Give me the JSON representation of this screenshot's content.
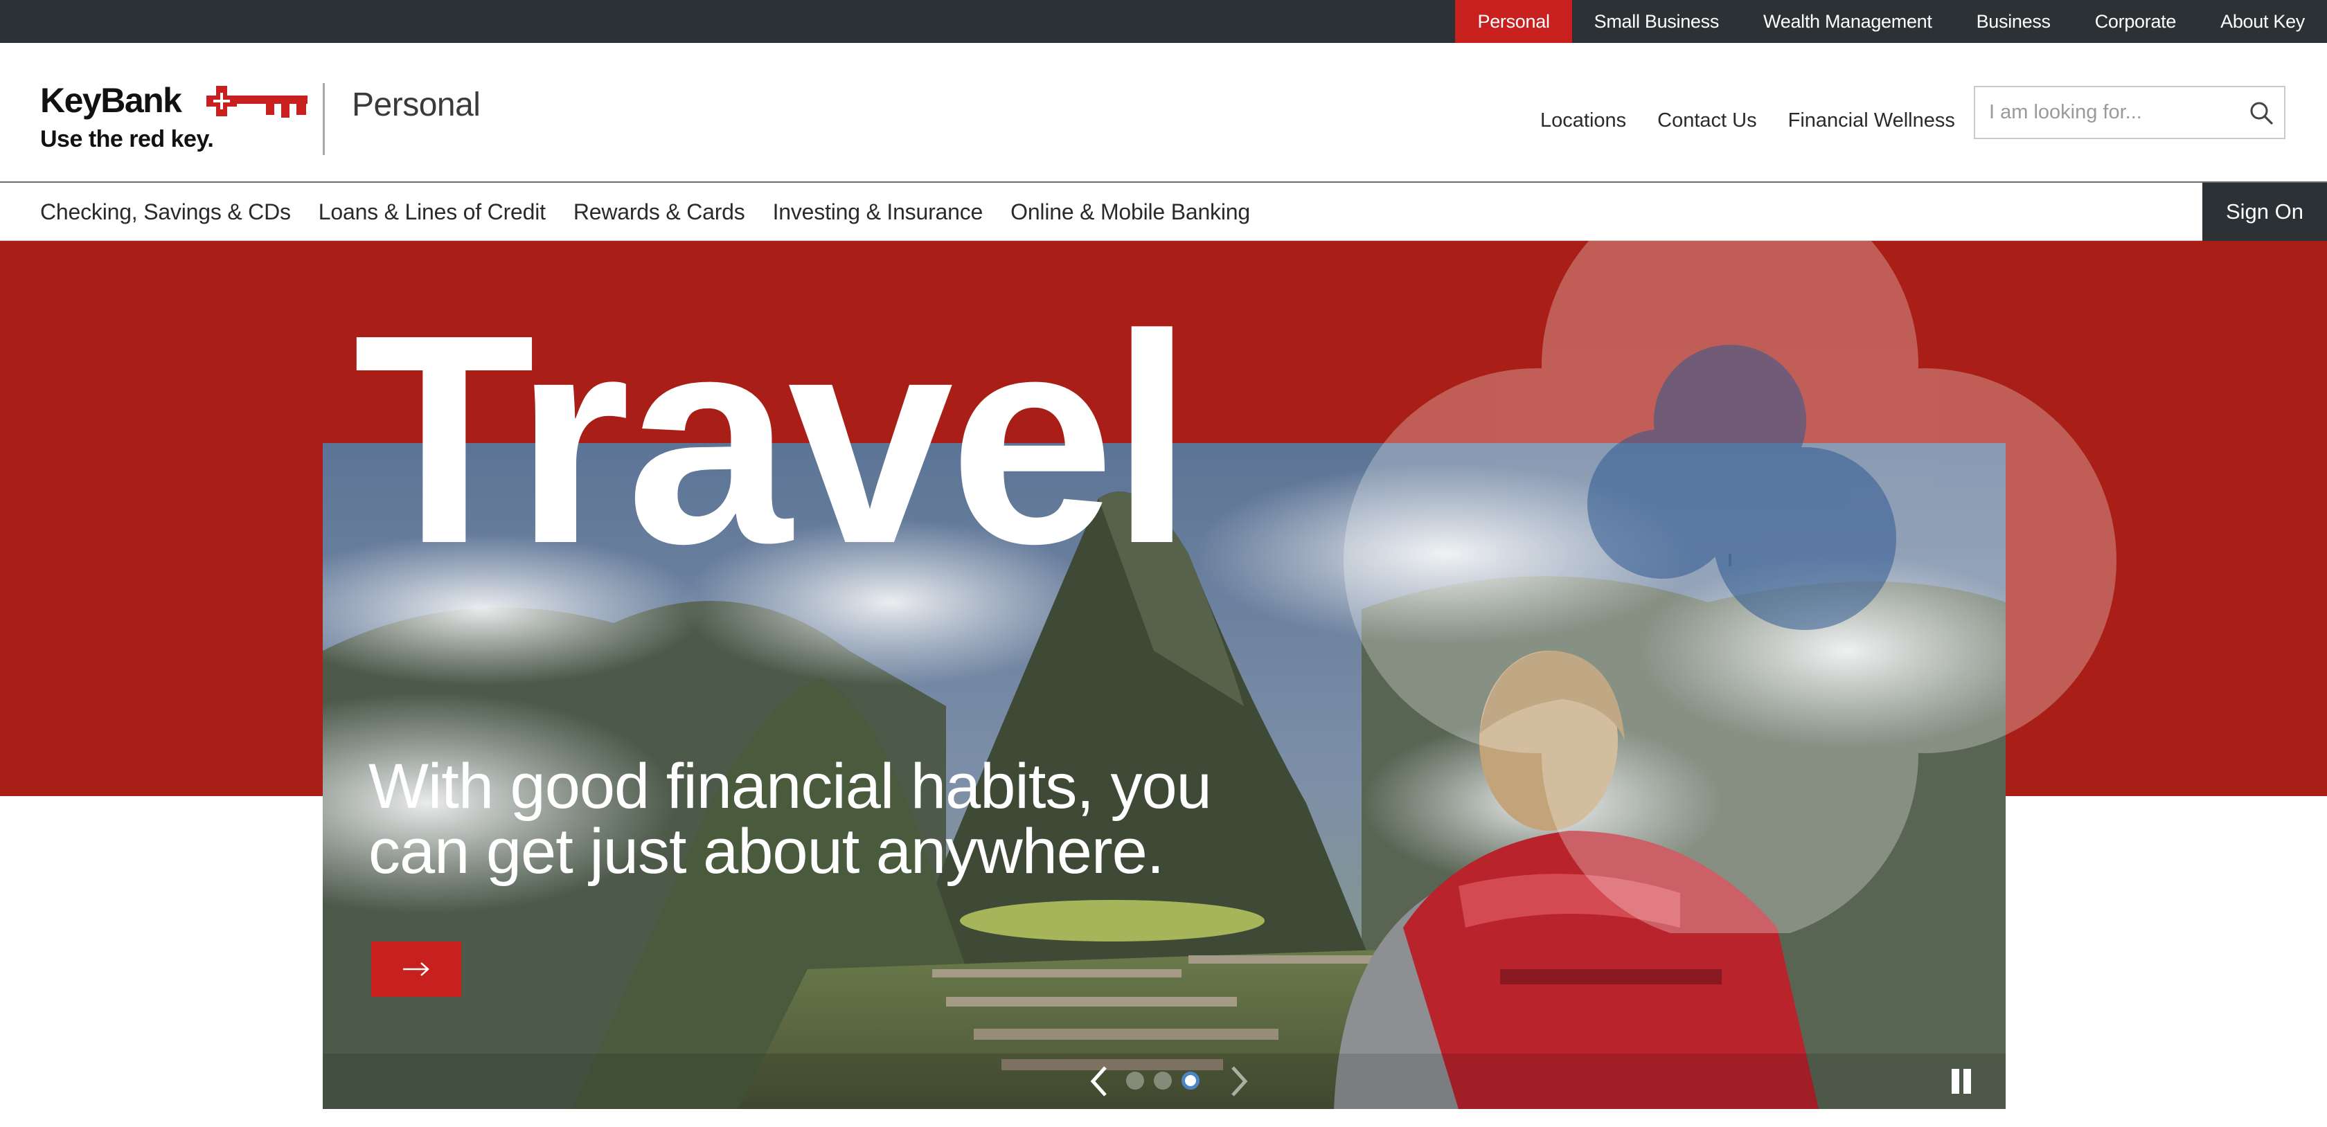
{
  "topbar": {
    "items": [
      {
        "label": "Personal",
        "active": true
      },
      {
        "label": "Small Business"
      },
      {
        "label": "Wealth Management"
      },
      {
        "label": "Business"
      },
      {
        "label": "Corporate"
      },
      {
        "label": "About Key"
      }
    ]
  },
  "brand": {
    "name": "KeyBank",
    "tagline": "Use the red key.",
    "accent": "#c8201f",
    "dark": "#2b3134"
  },
  "header": {
    "section": "Personal",
    "links": [
      "Locations",
      "Contact Us",
      "Financial Wellness"
    ],
    "search_placeholder": "I am looking for...",
    "search_icon": "search-icon"
  },
  "mainnav": {
    "items": [
      "Checking, Savings & CDs",
      "Loans & Lines of Credit",
      "Rewards & Cards",
      "Investing & Insurance",
      "Online & Mobile Banking"
    ],
    "signon": "Sign On"
  },
  "hero": {
    "headline": "Travel",
    "subtext": "With good financial habits, you can get just about anywhere.",
    "cta_icon": "arrow-right-icon",
    "slide_count": 3,
    "active_slide": 3,
    "pause_icon": "pause-icon"
  }
}
